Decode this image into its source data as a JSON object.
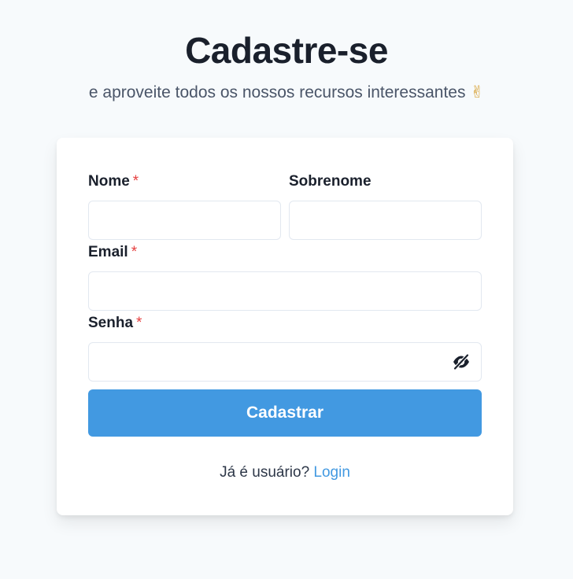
{
  "header": {
    "title": "Cadastre-se",
    "subtitle": "e aproveite todos os nossos recursos interessantes",
    "subtitle_emoji": "✌"
  },
  "form": {
    "first_name": {
      "label": "Nome",
      "required_mark": "*",
      "value": ""
    },
    "last_name": {
      "label": "Sobrenome",
      "value": ""
    },
    "email": {
      "label": "Email",
      "required_mark": "*",
      "value": ""
    },
    "password": {
      "label": "Senha",
      "required_mark": "*",
      "value": "",
      "toggle_icon": "eye-slash-icon"
    },
    "submit_label": "Cadastrar"
  },
  "footer": {
    "prompt": "Já é usuário?",
    "login_link": "Login"
  },
  "colors": {
    "background": "#f7fafc",
    "card": "#ffffff",
    "accent": "#4299e1",
    "required": "#e53e3e",
    "heading": "#1a202c",
    "subtitle": "#4a5568"
  }
}
